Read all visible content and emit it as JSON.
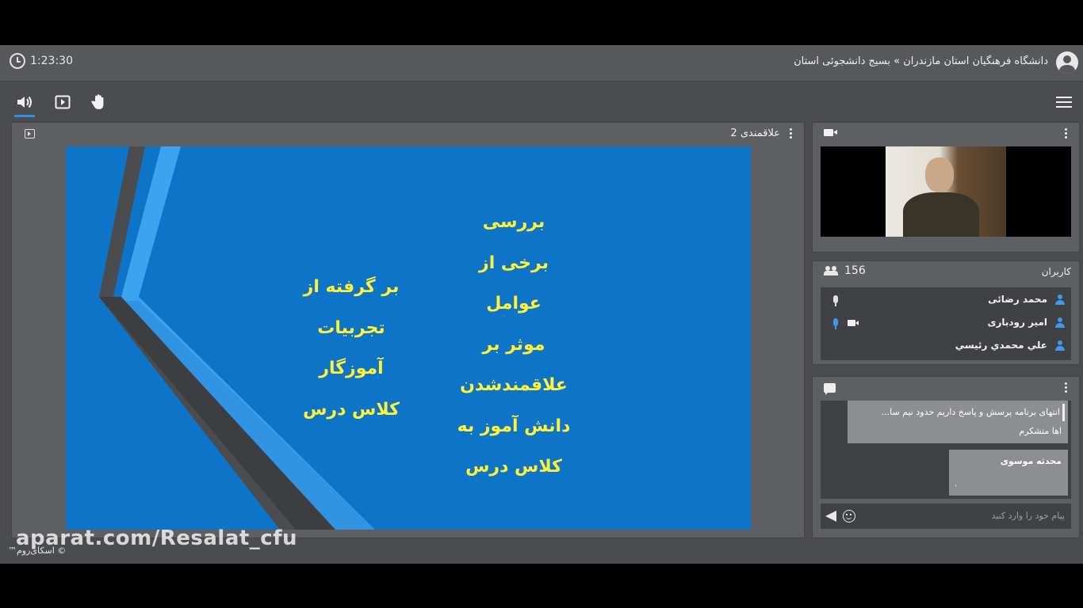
{
  "header": {
    "timer": "1:23:30",
    "room_title": "دانشگاه فرهنگیان استان مازندران » بسیج دانشجوئی استان"
  },
  "toolbar": {
    "icons": [
      "speaker-icon",
      "share-screen-icon",
      "raise-hand-icon",
      "hamburger-menu-icon"
    ]
  },
  "presentation": {
    "title": "علاقمندی 2",
    "slide": {
      "column_right": [
        "بررسی",
        "برخی از",
        "عوامل",
        "موثر بر",
        "علاقمندشدن",
        "دانش آموز به",
        "کلاس درس"
      ],
      "column_left": [
        "بر گرفته از",
        "تجربیات",
        "آموزگار",
        "کلاس درس"
      ],
      "text_color": "#fff23a",
      "background_color": "#0e74c8"
    }
  },
  "users": {
    "title": "کاربران",
    "count": "156",
    "list": [
      {
        "name": "محمد رضائی"
      },
      {
        "name": "امیر رودباری"
      },
      {
        "name": "علي محمدي رئيسي"
      }
    ]
  },
  "chat": {
    "messages": [
      {
        "text": "انتهای برنامه پرسش و پاسخ داریم حدود نیم سا...",
        "text2": "اها متشکرم"
      },
      {
        "sender": "محدثه موسوی",
        "text": "."
      }
    ],
    "input_placeholder": "پیام خود را وارد کنید"
  },
  "footer": {
    "watermark": "aparat.com/Resalat_cfu",
    "copyright": "© اسکای‌روم™"
  },
  "colors": {
    "accent": "#2f8fe0",
    "user_icon": "#3a9bee",
    "panel": "#5d5f62"
  }
}
